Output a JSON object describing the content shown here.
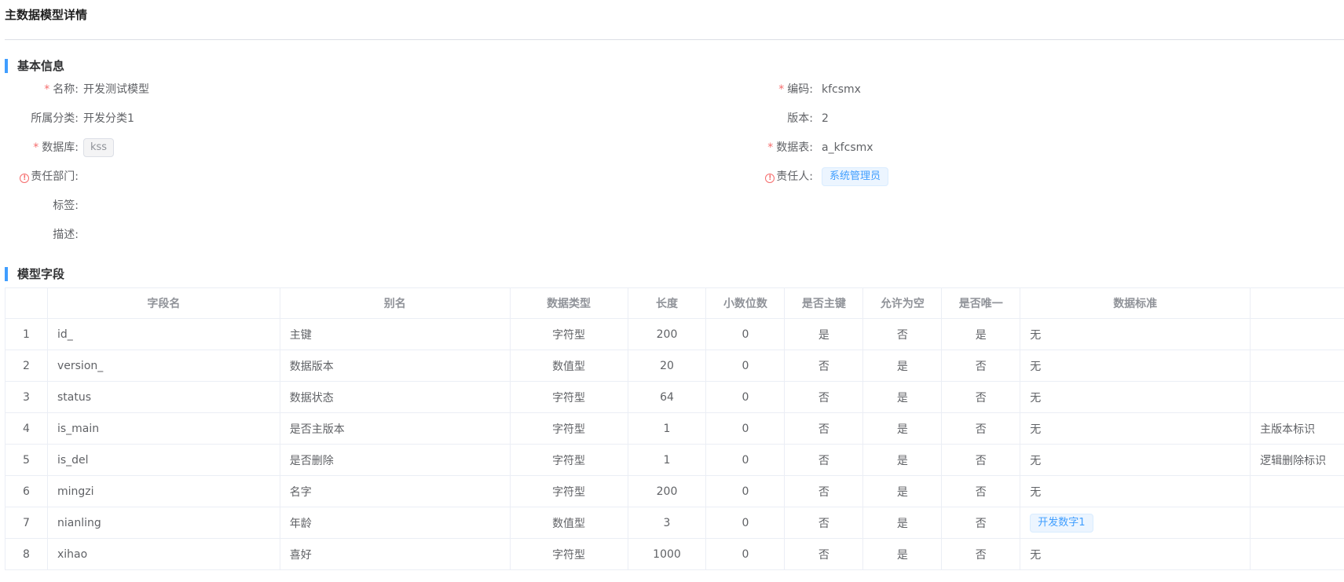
{
  "page": {
    "title": "主数据模型详情"
  },
  "basic": {
    "section_title": "基本信息",
    "name": {
      "label": "名称:",
      "value": "开发测试模型"
    },
    "code": {
      "label": "编码:",
      "value": "kfcsmx"
    },
    "category": {
      "label": "所属分类:",
      "value": "开发分类1"
    },
    "version": {
      "label": "版本:",
      "value": "2"
    },
    "database": {
      "label": "数据库:",
      "value": "kss"
    },
    "table": {
      "label": "数据表:",
      "value": "a_kfcsmx"
    },
    "dept": {
      "label": "责任部门:",
      "value": ""
    },
    "owner": {
      "label": "责任人:",
      "value": "系统管理员"
    },
    "tags": {
      "label": "标签:",
      "value": ""
    },
    "desc": {
      "label": "描述:",
      "value": ""
    },
    "required_mark": "*",
    "warn_mark": "!"
  },
  "fields": {
    "section_title": "模型字段",
    "columns": [
      "",
      "字段名",
      "别名",
      "数据类型",
      "长度",
      "小数位数",
      "是否主键",
      "允许为空",
      "是否唯一",
      "数据标准",
      ""
    ],
    "rows": [
      {
        "no": "1",
        "name": "id_",
        "alias": "主键",
        "type": "字符型",
        "length": "200",
        "decimals": "0",
        "pk": "是",
        "nullable": "否",
        "unique": "是",
        "standard": "无",
        "standard_tag": false,
        "remark": ""
      },
      {
        "no": "2",
        "name": "version_",
        "alias": "数据版本",
        "type": "数值型",
        "length": "20",
        "decimals": "0",
        "pk": "否",
        "nullable": "是",
        "unique": "否",
        "standard": "无",
        "standard_tag": false,
        "remark": ""
      },
      {
        "no": "3",
        "name": "status",
        "alias": "数据状态",
        "type": "字符型",
        "length": "64",
        "decimals": "0",
        "pk": "否",
        "nullable": "是",
        "unique": "否",
        "standard": "无",
        "standard_tag": false,
        "remark": ""
      },
      {
        "no": "4",
        "name": "is_main",
        "alias": "是否主版本",
        "type": "字符型",
        "length": "1",
        "decimals": "0",
        "pk": "否",
        "nullable": "是",
        "unique": "否",
        "standard": "无",
        "standard_tag": false,
        "remark": "主版本标识"
      },
      {
        "no": "5",
        "name": "is_del",
        "alias": "是否删除",
        "type": "字符型",
        "length": "1",
        "decimals": "0",
        "pk": "否",
        "nullable": "是",
        "unique": "否",
        "standard": "无",
        "standard_tag": false,
        "remark": "逻辑删除标识"
      },
      {
        "no": "6",
        "name": "mingzi",
        "alias": "名字",
        "type": "字符型",
        "length": "200",
        "decimals": "0",
        "pk": "否",
        "nullable": "是",
        "unique": "否",
        "standard": "无",
        "standard_tag": false,
        "remark": ""
      },
      {
        "no": "7",
        "name": "nianling",
        "alias": "年龄",
        "type": "数值型",
        "length": "3",
        "decimals": "0",
        "pk": "否",
        "nullable": "是",
        "unique": "否",
        "standard": "开发数字1",
        "standard_tag": true,
        "remark": ""
      },
      {
        "no": "8",
        "name": "xihao",
        "alias": "喜好",
        "type": "字符型",
        "length": "1000",
        "decimals": "0",
        "pk": "否",
        "nullable": "是",
        "unique": "否",
        "standard": "无",
        "standard_tag": false,
        "remark": ""
      }
    ]
  },
  "colors": {
    "accent": "#409eff",
    "required": "#f56c6c",
    "border": "#ebeef5"
  }
}
